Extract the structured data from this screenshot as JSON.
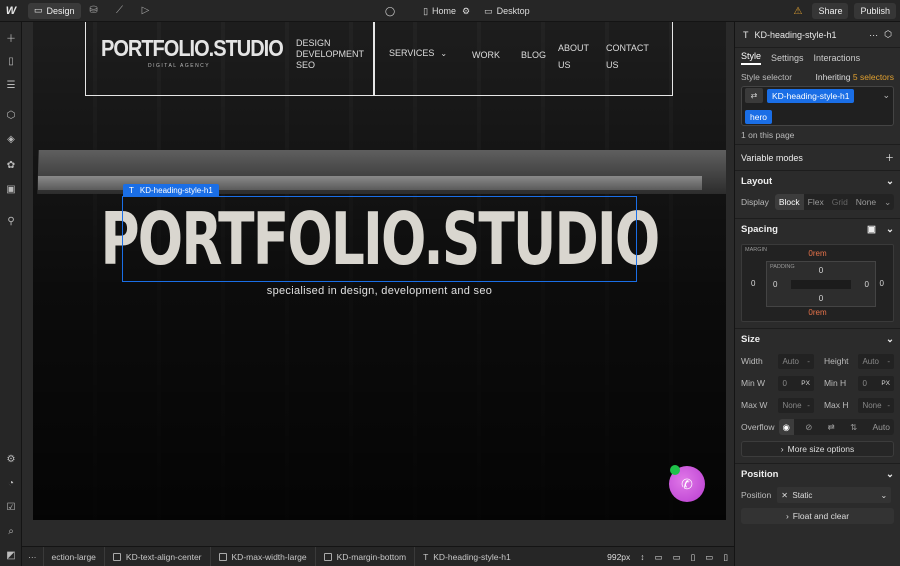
{
  "topbar": {
    "logo": "W",
    "design_label": "Design",
    "page_name": "Home",
    "breakpoint": "Desktop",
    "share_label": "Share",
    "publish_label": "Publish"
  },
  "site": {
    "logo": "PORTFOLIO.STUDIO",
    "logo_sub": "DIGITAL AGENCY",
    "nav_stack": [
      "DESIGN",
      "DEVELOPMENT",
      "SEO"
    ],
    "nav_services": "SERVICES",
    "nav_work": "WORK",
    "nav_blog": "BLOG",
    "nav_about": "ABOUT US",
    "nav_contact": "CONTACT US",
    "selected_tag": "KD-heading-style-h1",
    "hero_title": "PORTFOLIO.STUDIO",
    "hero_subtitle": "specialised in design, development and seo"
  },
  "breadcrumbs": [
    "ection-large",
    "KD-text-align-center",
    "KD-max-width-large",
    "KD-margin-bottom",
    "KD-heading-style-h1"
  ],
  "viewport": "992px",
  "panel": {
    "element_name": "KD-heading-style-h1",
    "tabs": [
      "Style",
      "Settings",
      "Interactions"
    ],
    "style_selector_label": "Style selector",
    "inheriting_label": "Inheriting",
    "inheriting_count": "5 selectors",
    "selector_chip": "KD-heading-style-h1",
    "combo_chip": "hero",
    "on_page": "1 on this page",
    "variable_modes": "Variable modes",
    "layout": {
      "title": "Layout",
      "display_label": "Display",
      "options": [
        "Block",
        "Flex",
        "Grid",
        "None"
      ]
    },
    "spacing": {
      "title": "Spacing",
      "margin_label": "MARGIN",
      "padding_label": "PADDING",
      "margin_top": "0rem",
      "margin_bottom": "0rem",
      "margin_left": "0",
      "margin_right": "0",
      "padding_top": "0",
      "padding_bottom": "0",
      "padding_left": "0",
      "padding_right": "0"
    },
    "size": {
      "title": "Size",
      "width_label": "Width",
      "width_val": "Auto",
      "height_label": "Height",
      "height_val": "Auto",
      "minw_label": "Min W",
      "minw_val": "0",
      "minh_label": "Min H",
      "minh_val": "0",
      "unit": "PX",
      "maxw_label": "Max W",
      "maxw_val": "None",
      "maxh_label": "Max H",
      "maxh_val": "None",
      "overflow_label": "Overflow",
      "overflow_auto": "Auto",
      "more_label": "More size options"
    },
    "position": {
      "title": "Position",
      "label": "Position",
      "value": "Static",
      "float_label": "Float and clear"
    }
  },
  "colors": {
    "accent": "#1a6ee6",
    "warning": "#e0a030",
    "margin_value": "#e8734a"
  }
}
